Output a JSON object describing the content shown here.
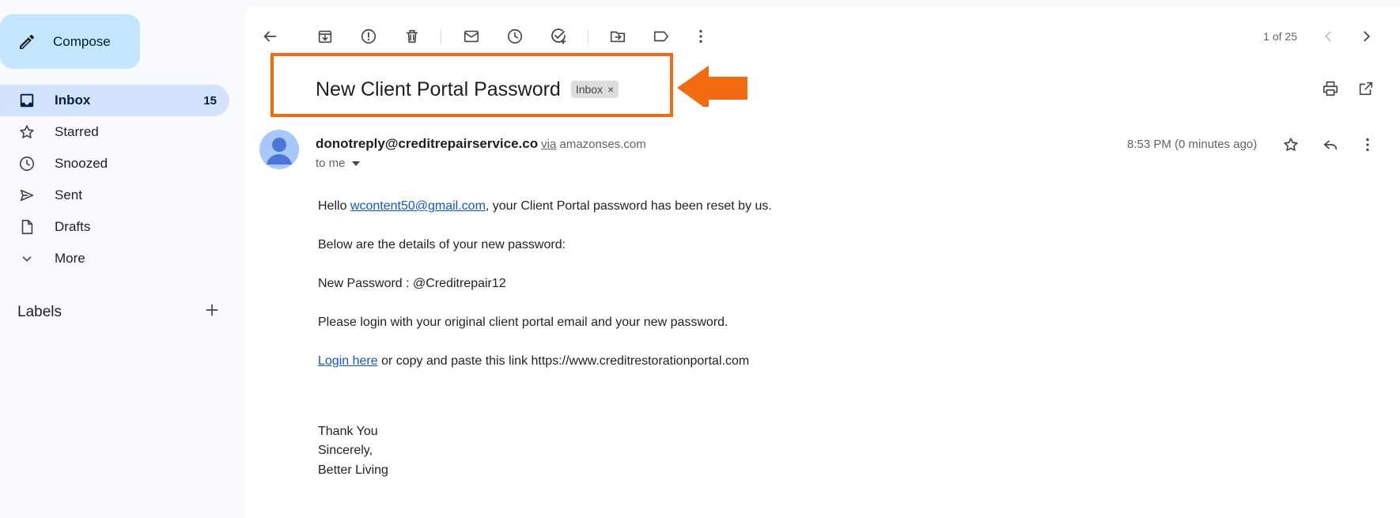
{
  "compose": {
    "label": "Compose"
  },
  "nav": {
    "items": [
      {
        "label": "Inbox",
        "count": "15",
        "icon": "inbox-icon"
      },
      {
        "label": "Starred",
        "icon": "star-icon"
      },
      {
        "label": "Snoozed",
        "icon": "clock-icon"
      },
      {
        "label": "Sent",
        "icon": "send-icon"
      },
      {
        "label": "Drafts",
        "icon": "draft-icon"
      },
      {
        "label": "More",
        "icon": "chevron-down-icon"
      }
    ]
  },
  "labels": {
    "title": "Labels"
  },
  "toolbar": {
    "pager": "1 of 25"
  },
  "email": {
    "subject": "New Client Portal Password",
    "label_chip": "Inbox",
    "chip_close": "×",
    "sender": "donotreply@creditrepairservice.co",
    "via_word": "via",
    "via_domain": "amazonses.com",
    "to": "to me",
    "time": "8:53 PM (0 minutes ago)",
    "body": {
      "hello_prefix": "Hello ",
      "hello_link": "wcontent50@gmail.com",
      "hello_suffix": ", your Client Portal password has been reset by us.",
      "line2": "Below are the details of your new password:",
      "line3": "New Password : @Creditrepair12",
      "line4": "Please login with your original client portal email and your new password.",
      "login_link": "Login here",
      "line5_suffix": " or copy and paste this link https://www.creditrestorationportal.com",
      "sign1": "Thank You",
      "sign2": "Sincerely,",
      "sign3": "Better Living"
    }
  },
  "colors": {
    "highlight": "#f26b0f",
    "compose_bg": "#c2e7ff",
    "inbox_active": "#d3e3fd",
    "link": "#1155cc"
  }
}
